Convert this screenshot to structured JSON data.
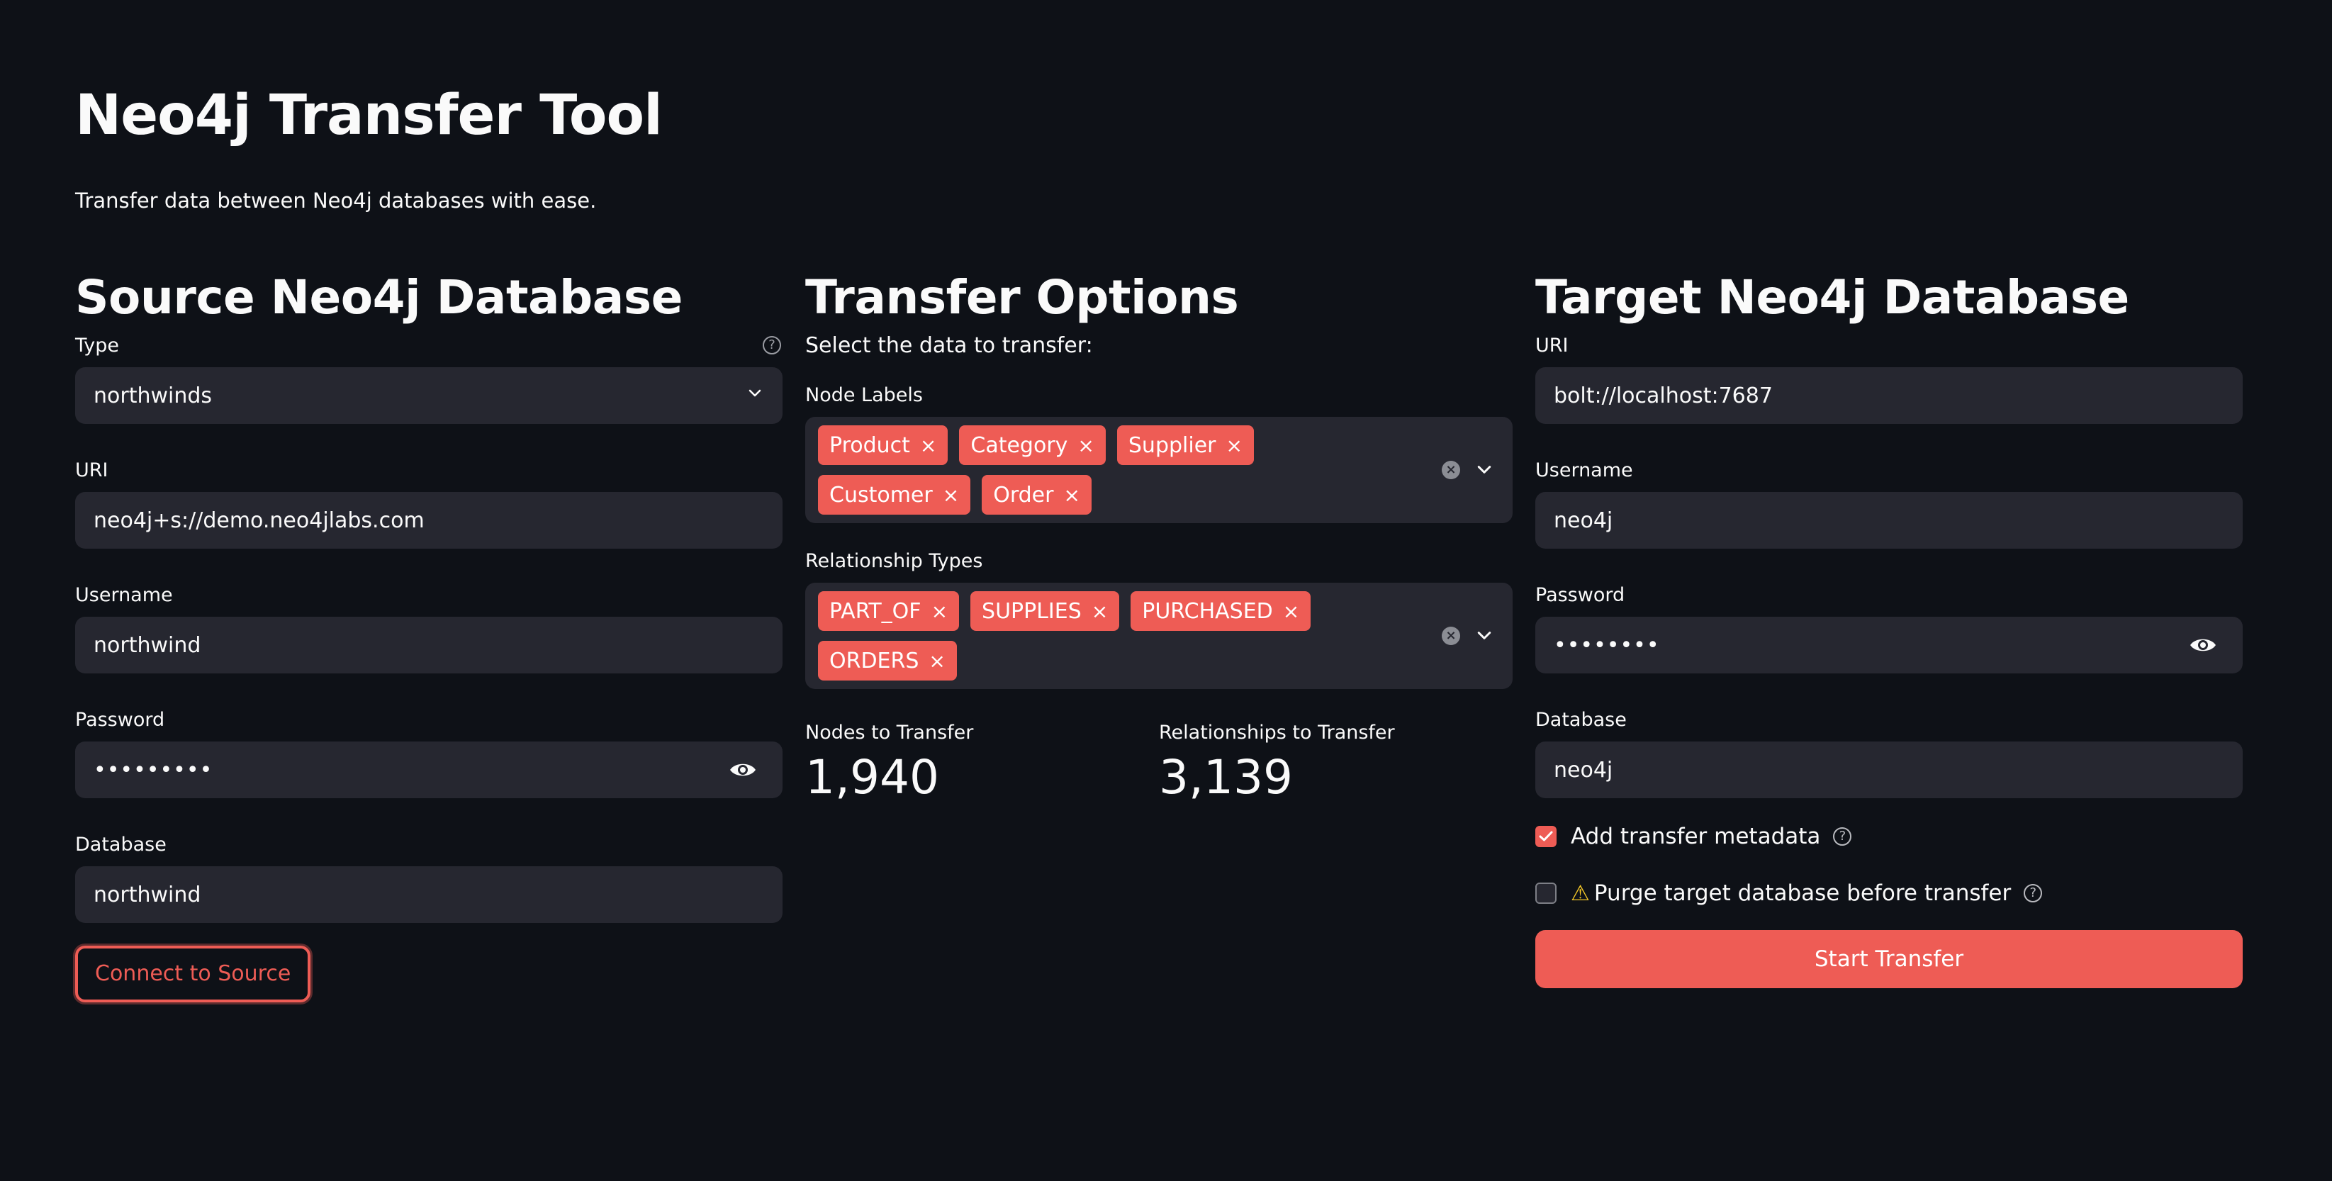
{
  "app": {
    "title": "Neo4j Transfer Tool",
    "subtitle": "Transfer data between Neo4j databases with ease."
  },
  "source": {
    "heading": "Source Neo4j Database",
    "type_label": "Type",
    "type_value": "northwinds",
    "uri_label": "URI",
    "uri_value": "neo4j+s://demo.neo4jlabs.com",
    "username_label": "Username",
    "username_value": "northwind",
    "password_label": "Password",
    "password_value": "•••••••••",
    "database_label": "Database",
    "database_value": "northwind",
    "connect_button": "Connect to Source"
  },
  "transfer": {
    "heading": "Transfer Options",
    "intro": "Select the data to transfer:",
    "node_labels_label": "Node Labels",
    "node_labels": [
      "Product",
      "Category",
      "Supplier",
      "Customer",
      "Order"
    ],
    "rel_types_label": "Relationship Types",
    "rel_types": [
      "PART_OF",
      "SUPPLIES",
      "PURCHASED",
      "ORDERS"
    ],
    "chip_remove": "×",
    "clear_glyph": "×",
    "nodes_label": "Nodes to Transfer",
    "nodes_value": "1,940",
    "rels_label": "Relationships to Transfer",
    "rels_value": "3,139"
  },
  "target": {
    "heading": "Target Neo4j Database",
    "uri_label": "URI",
    "uri_value": "bolt://localhost:7687",
    "username_label": "Username",
    "username_value": "neo4j",
    "password_label": "Password",
    "password_value": "••••••••",
    "database_label": "Database",
    "database_value": "neo4j",
    "metadata_label": "Add transfer metadata",
    "metadata_checked": true,
    "purge_label": "Purge target database before transfer",
    "purge_checked": false,
    "warn_icon": "⚠",
    "start_button": "Start Transfer"
  },
  "icons": {
    "help": "?"
  },
  "colors": {
    "accent": "#ee5c55",
    "background": "#0e1117",
    "input_bg": "#262730"
  }
}
